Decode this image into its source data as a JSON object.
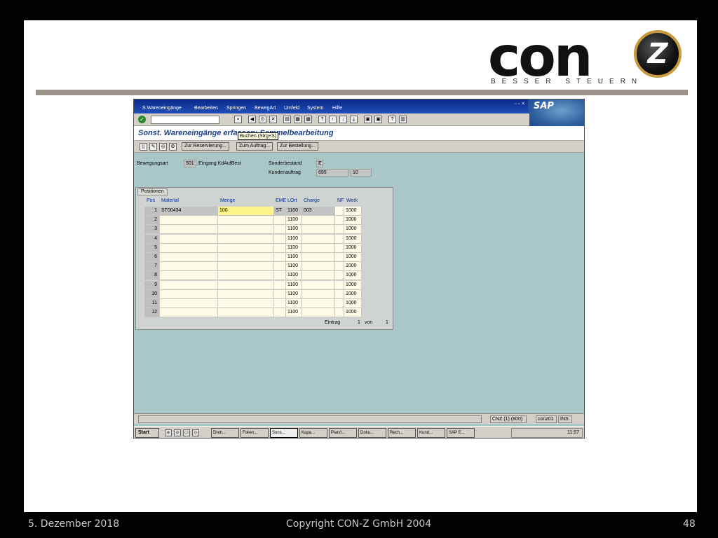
{
  "logo": {
    "wordmark": "con",
    "letter": "Z",
    "tagline": "BESSER STEUERN"
  },
  "sap": {
    "menu": [
      "S.Wareneingänge",
      "Bearbeiten",
      "Springen",
      "BewegArt",
      "Umfeld",
      "System",
      "Hilfe"
    ],
    "logo_text": "SAP",
    "title": "Sonst. Wareneingänge erfassen: Sammelbearbeitung",
    "tooltip": "Buchen   (Strg+S)",
    "app_buttons": [
      "Zur Reservierung...",
      "Zum Auftrag...",
      "Zur Bestellung..."
    ],
    "header": {
      "bewegungsart_label": "Bewegungsart",
      "bewegungsart_value": "501",
      "bewegungsart_text": "Eingang KdAufBest",
      "sonderbestand_label": "Sonderbestand",
      "sonderbestand_value": "E",
      "kundenauftrag_label": "Kundenauftrag",
      "kundenauftrag_value": "695",
      "kundenauftrag_pos": "10"
    },
    "table": {
      "tab_label": "Positionen",
      "columns": [
        "Pos",
        "Material",
        "Menge",
        "EME",
        "LOrt",
        "Charge",
        "NF",
        "Werk"
      ],
      "rows": [
        {
          "pos": "1",
          "material": "ST00434",
          "menge": "100",
          "eme": "ST",
          "lort": "1100",
          "charge": "003",
          "nf": "",
          "werk": "1000"
        },
        {
          "pos": "2",
          "material": "",
          "menge": "",
          "eme": "",
          "lort": "1100",
          "charge": "",
          "nf": "",
          "werk": "1000"
        },
        {
          "pos": "3",
          "material": "",
          "menge": "",
          "eme": "",
          "lort": "1100",
          "charge": "",
          "nf": "",
          "werk": "1000"
        },
        {
          "pos": "4",
          "material": "",
          "menge": "",
          "eme": "",
          "lort": "1100",
          "charge": "",
          "nf": "",
          "werk": "1000"
        },
        {
          "pos": "5",
          "material": "",
          "menge": "",
          "eme": "",
          "lort": "1100",
          "charge": "",
          "nf": "",
          "werk": "1000"
        },
        {
          "pos": "6",
          "material": "",
          "menge": "",
          "eme": "",
          "lort": "1100",
          "charge": "",
          "nf": "",
          "werk": "1000"
        },
        {
          "pos": "7",
          "material": "",
          "menge": "",
          "eme": "",
          "lort": "1100",
          "charge": "",
          "nf": "",
          "werk": "1000"
        },
        {
          "pos": "8",
          "material": "",
          "menge": "",
          "eme": "",
          "lort": "1100",
          "charge": "",
          "nf": "",
          "werk": "1000"
        },
        {
          "pos": "9",
          "material": "",
          "menge": "",
          "eme": "",
          "lort": "1100",
          "charge": "",
          "nf": "",
          "werk": "1000"
        },
        {
          "pos": "10",
          "material": "",
          "menge": "",
          "eme": "",
          "lort": "1100",
          "charge": "",
          "nf": "",
          "werk": "1000"
        },
        {
          "pos": "11",
          "material": "",
          "menge": "",
          "eme": "",
          "lort": "1100",
          "charge": "",
          "nf": "",
          "werk": "1000"
        },
        {
          "pos": "12",
          "material": "",
          "menge": "",
          "eme": "",
          "lort": "1100",
          "charge": "",
          "nf": "",
          "werk": "1000"
        }
      ],
      "entry_label": "Eintrag",
      "entry_current": "1",
      "entry_of": "von",
      "entry_total": "1"
    },
    "status": {
      "system": "CNZ (1) (800)",
      "server": "conz01",
      "mode": "INS"
    },
    "taskbar": {
      "start": "Start",
      "tasks": [
        "Dreh...",
        "Folien...",
        "Sons...",
        "Kapa...",
        "Plan/I...",
        "Doku...",
        "Rech...",
        "Kund...",
        "SAP E..."
      ],
      "active_task": "Sons...",
      "clock": "11:57"
    }
  },
  "footer": {
    "date": "5. Dezember 2018",
    "copyright": "Copyright CON-Z GmbH 2004",
    "page": "48"
  }
}
